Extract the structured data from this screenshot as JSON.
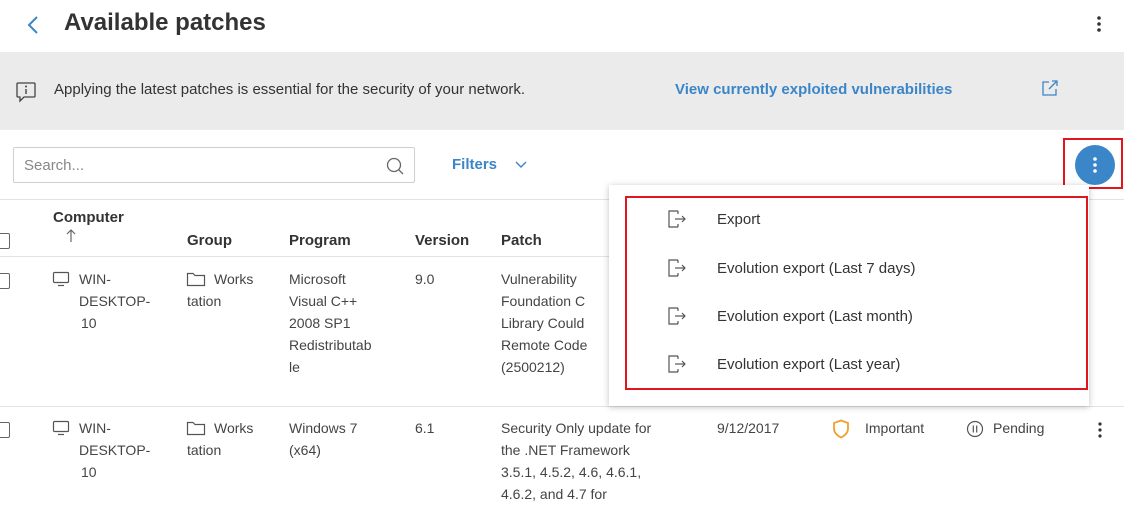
{
  "header": {
    "title": "Available patches",
    "back_icon": "chevron-left-icon",
    "menu_icon": "kebab-menu-icon"
  },
  "banner": {
    "text": "Applying the latest patches is essential for the security of your network.",
    "link": "View currently exploited vulnerabilities",
    "info_icon": "info-icon",
    "external_icon": "external-link-icon"
  },
  "toolbar": {
    "search_placeholder": "Search...",
    "filters_label": "Filters",
    "actions_icon": "kebab-menu-icon"
  },
  "table": {
    "columns": {
      "computer": "Computer",
      "group": "Group",
      "program": "Program",
      "version": "Version",
      "patch": "Patch"
    },
    "sort_icon": "arrow-up-icon",
    "rows": [
      {
        "computer": [
          "WIN-",
          "DESKTOP-",
          "10"
        ],
        "group": [
          "Works",
          "tation"
        ],
        "program": [
          "Microsoft",
          "Visual C++",
          "2008 SP1",
          "Redistributab",
          "le"
        ],
        "version": "9.0",
        "patch": [
          "Vulnerability",
          "Foundation C",
          "Library Could",
          "Remote Code",
          "(2500212)"
        ]
      },
      {
        "computer": [
          "WIN-",
          "DESKTOP-",
          "10"
        ],
        "group": [
          "Works",
          "tation"
        ],
        "program": [
          "Windows 7",
          "(x64)"
        ],
        "version": "6.1",
        "patch": [
          "Security Only update for",
          "the .NET Framework",
          "3.5.1, 4.5.2, 4.6, 4.6.1,",
          "4.6.2, and 4.7 for"
        ],
        "date": "9/12/2017",
        "criticality": "Important",
        "status": "Pending"
      }
    ]
  },
  "export_menu": {
    "items": [
      {
        "label": "Export",
        "icon": "export-icon"
      },
      {
        "label": "Evolution export (Last 7 days)",
        "icon": "export-icon"
      },
      {
        "label": "Evolution export (Last month)",
        "icon": "export-icon"
      },
      {
        "label": "Evolution export (Last year)",
        "icon": "export-icon"
      }
    ]
  },
  "colors": {
    "accent": "#3a86c8",
    "highlight": "#e0171d",
    "banner_bg": "#ebebeb",
    "important": "#f0a030"
  }
}
